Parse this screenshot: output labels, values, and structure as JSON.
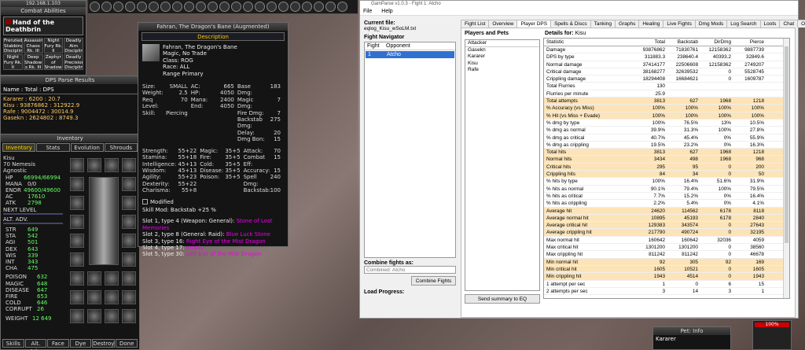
{
  "game": {
    "target": {
      "ip": "192.168.1.103",
      "window_title": "Combat Abilities",
      "name": "Hand of the Deathbrin",
      "abilities": [
        "Frenzied Stabbing Disciplin",
        "Assassin's Chaos Rk. III",
        "Night Fury Rk. II",
        "Deadly Aim Disciplin",
        "Night Fury Rk. II",
        "Deep Shadow s Rk. III",
        "Zephyr of Shadows",
        "Deadly Precision Disciplin"
      ]
    },
    "dps": {
      "title": "DPS Parse Results",
      "header": "Name : Total : DPS",
      "rows": [
        "Kararer : 6200 : 20.7",
        "Kisu : 93876862 : 312922.9",
        "Rafe : 9004472 : 30014.9",
        "Gasekn : 2624802 : 8749.3"
      ]
    },
    "inventory": {
      "title": "Inventory",
      "tabs": [
        "Inventory",
        "Stats",
        "Evolution",
        "Shrouds"
      ],
      "char_name": "Kisu",
      "level_class": "70 Nemesis",
      "deity": "Agnostic",
      "hp_label": "HP",
      "hp": "66994/66994",
      "mana_label": "MANA",
      "mana": "0/0",
      "endr_label": "ENDR",
      "endr": "49600/49600",
      "ac_label": "AC",
      "ac": "17610",
      "atk_label": "ATK",
      "atk": "2798",
      "next_level": "NEXT LEVEL",
      "alt_adv": "ALT. ADV.",
      "stats": [
        {
          "k": "STR",
          "v": "649"
        },
        {
          "k": "STA",
          "v": "542"
        },
        {
          "k": "AGI",
          "v": "501"
        },
        {
          "k": "DEX",
          "v": "643"
        },
        {
          "k": "WIS",
          "v": "339"
        },
        {
          "k": "INT",
          "v": "343"
        },
        {
          "k": "CHA",
          "v": "475"
        }
      ],
      "resists": [
        {
          "k": "POISON",
          "v": "632"
        },
        {
          "k": "MAGIC",
          "v": "648"
        },
        {
          "k": "DISEASE",
          "v": "647"
        },
        {
          "k": "FIRE",
          "v": "653"
        },
        {
          "k": "COLD",
          "v": "646"
        },
        {
          "k": "CORRUPT",
          "v": "26"
        }
      ],
      "weight_label": "WEIGHT",
      "weight": "12 649",
      "buttons": [
        "Skills",
        "Alt. Adv.",
        "Face",
        "Dye",
        "Destroy",
        "Done"
      ]
    },
    "item": {
      "title": "Fahran, The Dragon's Bane (Augmented)",
      "desc_label": "Description",
      "name": "Fahran, The Dragon's Bane",
      "flags": "Magic, No Trade",
      "class": "Class: ROG",
      "race": "Race:  ALL",
      "range": "Range Primary",
      "col1": [
        [
          "Size:",
          "SMALL"
        ],
        [
          "Weight:",
          "2.5"
        ],
        [
          "Req Level:",
          "70"
        ],
        [
          "Skill:",
          "Piercing"
        ]
      ],
      "col2": [
        [
          "AC:",
          "665"
        ],
        [
          "HP:",
          "4050"
        ],
        [
          "Mana:",
          "2400"
        ],
        [
          "End:",
          "4050"
        ]
      ],
      "col3": [
        [
          "Base Dmg:",
          "183"
        ],
        [
          "Magic Dmg:",
          "7"
        ],
        [
          "Fire Dmg:",
          "7"
        ],
        [
          "Backstab Dmg:",
          "275"
        ],
        [
          "Delay:",
          "20"
        ],
        [
          "Dmg Bon:",
          "15"
        ]
      ],
      "attr1": [
        [
          "Strength:",
          "55+22"
        ],
        [
          "Stamina:",
          "55+18"
        ],
        [
          "Intelligence:",
          "45+13"
        ],
        [
          "Wisdom:",
          "45+13"
        ],
        [
          "Agility:",
          "55+23"
        ],
        [
          "Dexterity:",
          "55+22"
        ],
        [
          "Charisma:",
          "55+8"
        ]
      ],
      "attr2": [
        [
          "Magic:",
          "35+5"
        ],
        [
          "Fire:",
          "35+5"
        ],
        [
          "Cold:",
          "35+5"
        ],
        [
          "Disease:",
          "35+5"
        ],
        [
          "Poison:",
          "35+5"
        ]
      ],
      "attr3": [
        [
          "Attack:",
          "70"
        ],
        [
          "Combat Eff:",
          "15"
        ],
        [
          "Accuracy:",
          "15"
        ],
        [
          "Spell Dmg:",
          "240"
        ],
        [
          "Backstab:",
          "100"
        ]
      ],
      "modified": "Modified",
      "skillmod": "Skill Mod: Backstab +25 %",
      "slots": [
        {
          "t": "Slot 1, type 4 (Weapon: General): ",
          "v": "Stone of Lost Memories"
        },
        {
          "t": "Slot 2, type 8 (General: Raid): ",
          "v": "Blue Luck Stone"
        },
        {
          "t": "Slot 3, type 16: ",
          "v": "Right Eye of the Mist Dragon"
        },
        {
          "t": "Slot 4, type 17: ",
          "v": "empty"
        },
        {
          "t": "Slot 5, type 30: ",
          "v": "Left Eye of the Mist Dragon"
        }
      ]
    },
    "pet_title": "Pet: Info",
    "pet_name": "Kararer",
    "hp_pct": "100%"
  },
  "app": {
    "title": "GamParse v1.0.3 - Fight 1: Atcho",
    "menu": [
      "File",
      "Help"
    ],
    "current_file_label": "Current file:",
    "current_file": "eqlog_Kisu_wSoLM.txt",
    "fight_nav_label": "Fight Navigator",
    "fight_cols": [
      "Fight",
      "Opponent"
    ],
    "fight_rows": [
      [
        "1",
        "Atcho"
      ]
    ],
    "combine_label": "Combine fights as:",
    "combine_value": "Combined: Atcho",
    "combine_btn": "Combine Fights",
    "load_label": "Load Progress:",
    "tabs": [
      "Fight List",
      "Overview",
      "Player DPS",
      "Spells & Discs",
      "Tanking",
      "Graphs",
      "Healing",
      "Live Fights",
      "Dmg Mods",
      "Log Search",
      "Loots",
      "Chat",
      "Options"
    ],
    "players_label": "Players and Pets",
    "details_label": "Details for:",
    "details_for": "Kisu",
    "players": [
      "Attacker",
      "Gasekn",
      "Kararer",
      "Kisu",
      "Rafe"
    ],
    "send_btn": "Send summary to EQ",
    "table_cols": [
      "Statistic",
      "Total",
      "Backstab",
      "DirDmg",
      "Pierce"
    ],
    "rows": [
      {
        "s": "Damage",
        "v": [
          "93876862",
          "71830761",
          "12158362",
          "9887739"
        ],
        "h": 0
      },
      {
        "s": "DPS by type",
        "v": [
          "311883.3",
          "238640.4",
          "40393.2",
          "32849.6"
        ],
        "h": 0
      },
      {
        "s": "Normal damage",
        "v": [
          "37414177",
          "22506608",
          "12158362",
          "2749207"
        ],
        "h": 0
      },
      {
        "s": "Critical damage",
        "v": [
          "38168277",
          "32639532",
          "0",
          "5528745"
        ],
        "h": 0
      },
      {
        "s": "Crippling damage",
        "v": [
          "18294408",
          "16684621",
          "0",
          "1609787"
        ],
        "h": 0
      },
      {
        "s": "Total Flurries",
        "v": [
          "130",
          "",
          "",
          ""
        ],
        "h": 0
      },
      {
        "s": "Flurries per minute",
        "v": [
          "25.9",
          "",
          "",
          ""
        ],
        "h": 0
      },
      {
        "s": "Total attempts",
        "v": [
          "3813",
          "627",
          "1968",
          "1218"
        ],
        "h": 1
      },
      {
        "s": "% Accuracy (vs Miss)",
        "v": [
          "100%",
          "100%",
          "100%",
          "100%"
        ],
        "h": 1
      },
      {
        "s": "% Hit (vs Miss + Evade)",
        "v": [
          "100%",
          "100%",
          "100%",
          "100%"
        ],
        "h": 1
      },
      {
        "s": "% dmg by type",
        "v": [
          "100%",
          "76.5%",
          "13%",
          "10.5%"
        ],
        "h": 0
      },
      {
        "s": "% dmg as normal",
        "v": [
          "39.9%",
          "31.3%",
          "100%",
          "27.8%"
        ],
        "h": 0
      },
      {
        "s": "% dmg as critical",
        "v": [
          "40.7%",
          "45.4%",
          "0%",
          "55.9%"
        ],
        "h": 0
      },
      {
        "s": "% dmg as crippling",
        "v": [
          "19.5%",
          "23.2%",
          "0%",
          "16.3%"
        ],
        "h": 0
      },
      {
        "s": "Total hits",
        "v": [
          "3813",
          "627",
          "1968",
          "1218"
        ],
        "h": 1
      },
      {
        "s": "Normal hits",
        "v": [
          "3434",
          "498",
          "1968",
          "968"
        ],
        "h": 1
      },
      {
        "s": "Critical hits",
        "v": [
          "295",
          "95",
          "0",
          "200"
        ],
        "h": 1
      },
      {
        "s": "Crippling hits",
        "v": [
          "84",
          "34",
          "0",
          "50"
        ],
        "h": 1
      },
      {
        "s": "% hits by type",
        "v": [
          "100%",
          "16.4%",
          "51.6%",
          "31.9%"
        ],
        "h": 0
      },
      {
        "s": "% hits as normal",
        "v": [
          "90.1%",
          "79.4%",
          "100%",
          "79.5%"
        ],
        "h": 0
      },
      {
        "s": "% hits as critical",
        "v": [
          "7.7%",
          "15.2%",
          "0%",
          "16.4%"
        ],
        "h": 0
      },
      {
        "s": "% hits as crippling",
        "v": [
          "2.2%",
          "5.4%",
          "0%",
          "4.1%"
        ],
        "h": 0
      },
      {
        "s": "Average hit",
        "v": [
          "24620",
          "114562",
          "6178",
          "8118"
        ],
        "h": 1
      },
      {
        "s": "Average normal hit",
        "v": [
          "10895",
          "45193",
          "6178",
          "2840"
        ],
        "h": 1
      },
      {
        "s": "Average critical hit",
        "v": [
          "129383",
          "343574",
          "0",
          "27643"
        ],
        "h": 1
      },
      {
        "s": "Average crippling hit",
        "v": [
          "217790",
          "490724",
          "0",
          "32195"
        ],
        "h": 1
      },
      {
        "s": "Max normal hit",
        "v": [
          "160642",
          "160642",
          "32036",
          "4059"
        ],
        "h": 0
      },
      {
        "s": "Max critical hit",
        "v": [
          "1301200",
          "1301200",
          "0",
          "38560"
        ],
        "h": 0
      },
      {
        "s": "Max crippling hit",
        "v": [
          "811242",
          "811242",
          "0",
          "46678"
        ],
        "h": 0
      },
      {
        "s": "Min normal hit",
        "v": [
          "92",
          "305",
          "92",
          "169"
        ],
        "h": 1
      },
      {
        "s": "Min critical hit",
        "v": [
          "1605",
          "10521",
          "0",
          "1605"
        ],
        "h": 1
      },
      {
        "s": "Min crippling hit",
        "v": [
          "1943",
          "4514",
          "0",
          "1943"
        ],
        "h": 1
      },
      {
        "s": "1 attempt per sec",
        "v": [
          "1",
          "0",
          "6",
          "15"
        ],
        "h": 0
      },
      {
        "s": "2 attempts per sec",
        "v": [
          "3",
          "14",
          "3",
          "1"
        ],
        "h": 0
      }
    ]
  }
}
